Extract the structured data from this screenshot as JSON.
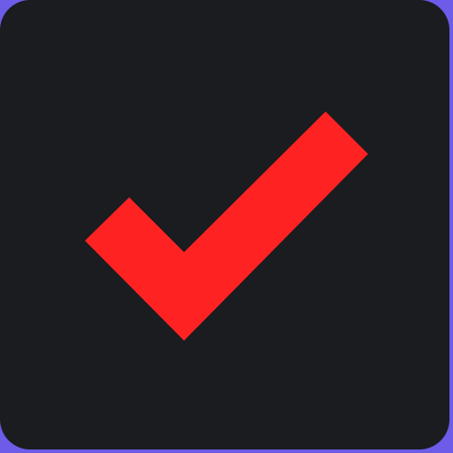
{
  "app_icon": {
    "icon": "checkmark-icon",
    "state": "checked",
    "colors": {
      "border_accent": "#6c5ce7",
      "tile_background": "#1a1c20",
      "checkmark": "#ff2222"
    }
  }
}
